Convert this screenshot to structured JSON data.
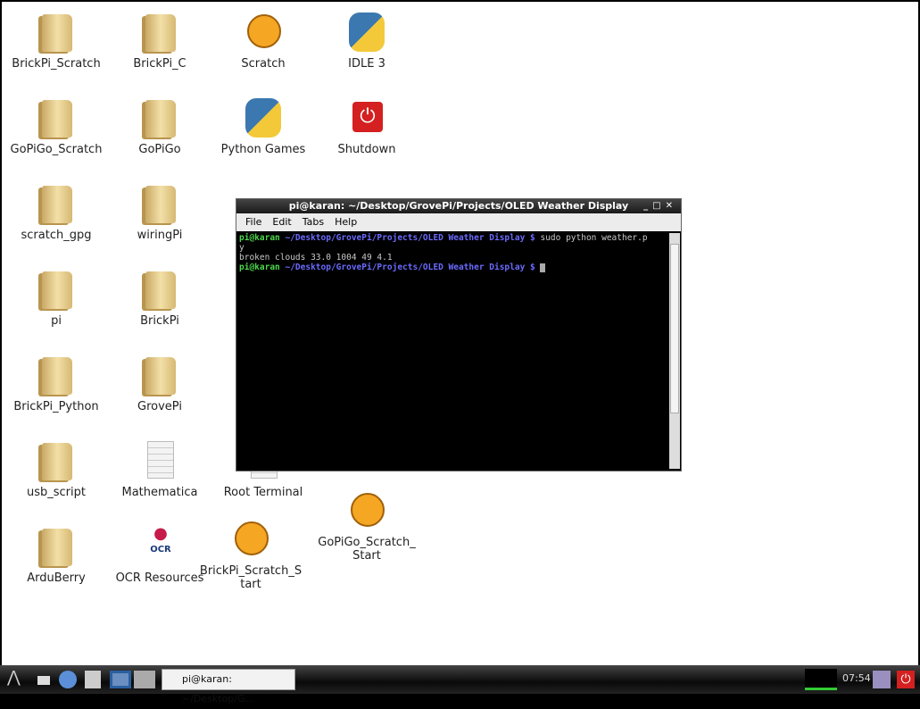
{
  "desktop": {
    "icons": [
      {
        "label": "BrickPi_Scratch",
        "icon": "folder-icon"
      },
      {
        "label": "GoPiGo_Scratch",
        "icon": "folder-icon"
      },
      {
        "label": "scratch_gpg",
        "icon": "folder-icon"
      },
      {
        "label": "pi",
        "icon": "folder-icon"
      },
      {
        "label": "BrickPi_Python",
        "icon": "folder-icon"
      },
      {
        "label": "usb_script",
        "icon": "folder-icon"
      },
      {
        "label": "ArduBerry",
        "icon": "folder-icon"
      },
      {
        "label": "BrickPi_C",
        "icon": "folder-icon"
      },
      {
        "label": "GoPiGo",
        "icon": "folder-icon"
      },
      {
        "label": "wiringPi",
        "icon": "folder-icon"
      },
      {
        "label": "BrickPi",
        "icon": "folder-icon"
      },
      {
        "label": "GrovePi",
        "icon": "folder-icon"
      },
      {
        "label": "Mathematica",
        "icon": "document-icon"
      },
      {
        "label": "OCR Resources",
        "icon": "raspberry-ocr-icon"
      },
      {
        "label": "Scratch",
        "icon": "scratch-cat-icon"
      },
      {
        "label": "Python Games",
        "icon": "python-icon"
      },
      {
        "label": "Root Terminal",
        "icon": "terminal-icon"
      },
      {
        "label": "BrickPi_Scratch_Start",
        "icon": "scratch-cat-icon"
      },
      {
        "label": "IDLE 3",
        "icon": "python-icon"
      },
      {
        "label": "Shutdown",
        "icon": "power-icon"
      },
      {
        "label": "GoPiGo_Scratch_Start",
        "icon": "scratch-cat-icon"
      }
    ]
  },
  "terminal": {
    "title": "pi@karan: ~/Desktop/GrovePi/Projects/OLED Weather Display",
    "menu": [
      "File",
      "Edit",
      "Tabs",
      "Help"
    ],
    "user": "pi@karan",
    "path": " ~/Desktop/GrovePi/Projects/OLED Weather Display $",
    "command": " sudo python weather.p\ny",
    "output": "broken clouds 33.0 1004 49 4.1"
  },
  "taskbar": {
    "task_label": "pi@karan: ~/Desktop/G...",
    "clock": "07:54"
  },
  "colors": {
    "prompt_user": "#4cd64c",
    "prompt_path": "#6a6aff",
    "shutdown": "#d42020"
  }
}
